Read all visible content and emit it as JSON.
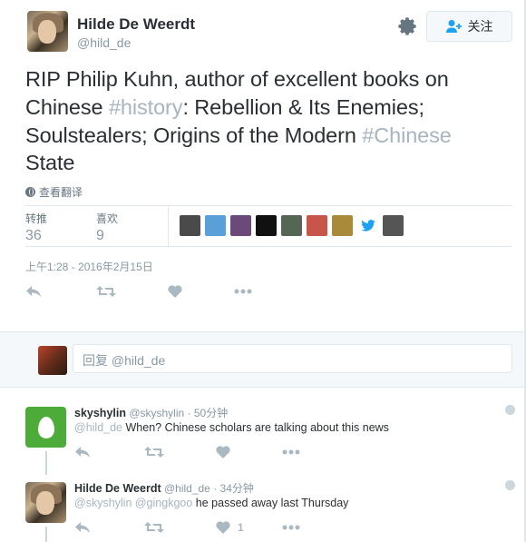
{
  "author": {
    "name": "Hilde De Weerdt",
    "handle": "@hild_de"
  },
  "follow_button": {
    "label": "关注",
    "icon": "add-user-icon"
  },
  "settings_icon": "gear-icon",
  "tweet": {
    "parts": [
      {
        "type": "text",
        "value": "RIP Philip Kuhn, author of excellent books on Chinese "
      },
      {
        "type": "hashtag",
        "value": "#history"
      },
      {
        "type": "text",
        "value": ": Rebellion & Its Enemies; Soulstealers; Origins of the Modern "
      },
      {
        "type": "hashtag",
        "value": "#Chinese"
      },
      {
        "type": "text",
        "value": " State"
      }
    ],
    "translate_label": "查看翻译"
  },
  "stats": {
    "retweets_label": "转推",
    "retweets_count": "36",
    "likes_label": "喜欢",
    "likes_count": "9"
  },
  "likers": [
    "#4a4a4a",
    "#5aa0d8",
    "#6b4a7a",
    "#111111",
    "#556655",
    "#c8554a",
    "#a88a3a",
    "bird",
    "#555555"
  ],
  "timestamp": "上午1:28 - 2016年2月15日",
  "actions": {
    "reply_icon": "reply-icon",
    "retweet_icon": "retweet-icon",
    "like_icon": "heart-icon",
    "more_icon": "more-icon"
  },
  "reply_box": {
    "placeholder": "回复 @hild_de"
  },
  "replies": [
    {
      "name": "skyshylin",
      "handle": "@skyshylin",
      "time": "· 50分钟",
      "mention": "@hild_de",
      "text": " When? Chinese scholars are talking about this news",
      "like_count": ""
    },
    {
      "name": "Hilde De Weerdt",
      "handle": "@hild_de",
      "time": "· 34分钟",
      "mention": "@skyshylin @gingkgoo",
      "text": "  he passed away last Thursday",
      "like_count": "1"
    }
  ],
  "colors": {
    "text": "#292f33",
    "muted": "#8899a6",
    "hashtag": "#a7b5c0",
    "egg": "#4dab3a",
    "twitter_blue": "#1da1f2"
  }
}
